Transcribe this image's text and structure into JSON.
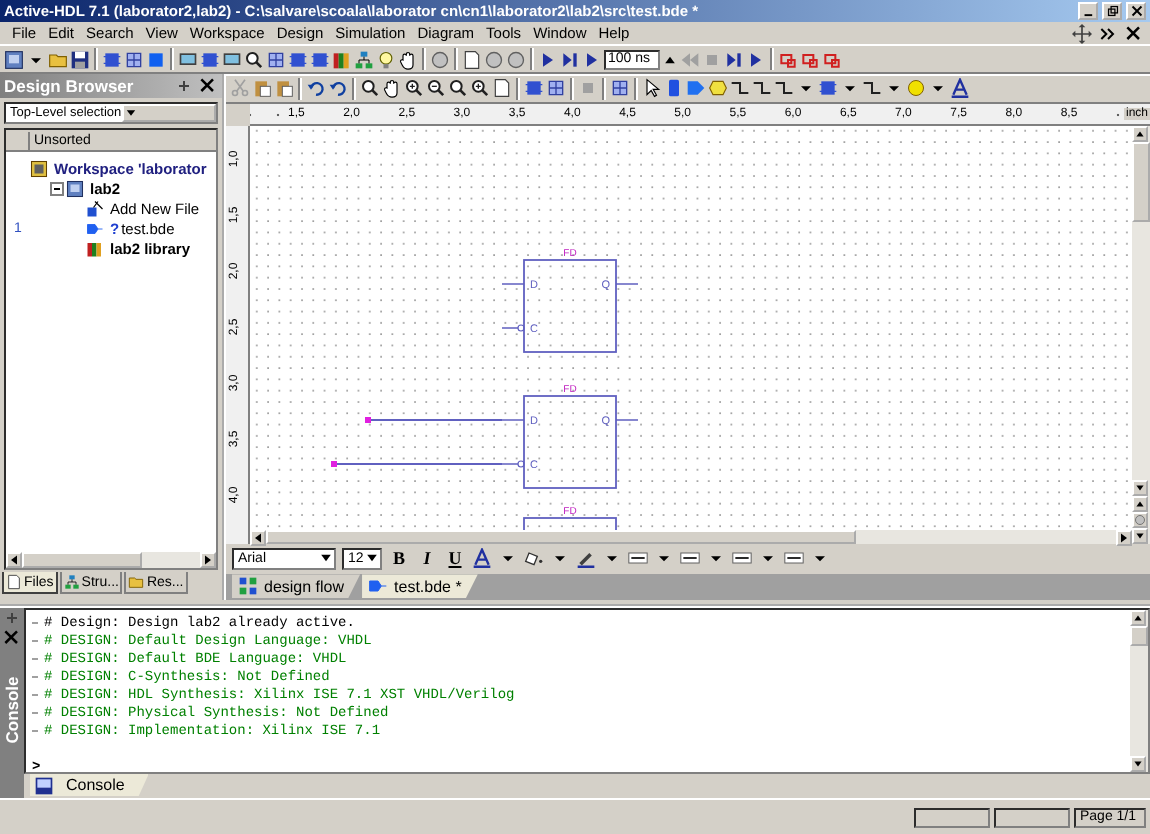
{
  "window": {
    "title": "Active-HDL 7.1 (laborator2,lab2) - C:\\salvare\\scoala\\laborator cn\\cn1\\laborator2\\lab2\\src\\test.bde *"
  },
  "menu": [
    "File",
    "Edit",
    "Search",
    "View",
    "Workspace",
    "Design",
    "Simulation",
    "Diagram",
    "Tools",
    "Window",
    "Help"
  ],
  "sim_toolbar": {
    "time": "100 ns"
  },
  "design_browser": {
    "title": "Design Browser",
    "selector": "Top-Level selection",
    "column": "Unsorted",
    "tree": [
      {
        "label": "Workspace 'laborator",
        "kind": "workspace",
        "children": [
          {
            "label": "lab2",
            "kind": "design",
            "expanded": true,
            "children": [
              {
                "label": "Add New File",
                "kind": "add"
              },
              {
                "label": "test.bde",
                "kind": "bde",
                "status": "?",
                "mark": "1"
              },
              {
                "label": "lab2 library",
                "kind": "library"
              }
            ]
          }
        ]
      }
    ],
    "tabs": [
      {
        "label": "Files",
        "selected": true
      },
      {
        "label": "Stru...",
        "selected": false
      },
      {
        "label": "Res...",
        "selected": false
      }
    ]
  },
  "ruler": {
    "x_labels": [
      "1,5",
      "2,0",
      "2,5",
      "3,0",
      "3,5",
      "4,0",
      "4,5",
      "5,0",
      "5,5",
      "6,0",
      "6,5",
      "7,0",
      "7,5",
      "8,0",
      "8,5"
    ],
    "unit": "inch",
    "y_labels": [
      "1,0",
      "1,5",
      "2,0",
      "2,5",
      "3,0",
      "3,5",
      "4,0"
    ]
  },
  "diagram": {
    "blocks": [
      {
        "name": "FD",
        "pins": [
          "D",
          "Q",
          "C"
        ],
        "inputs_wired": false
      },
      {
        "name": "FD",
        "pins": [
          "D",
          "Q",
          "C"
        ],
        "inputs_wired": true
      },
      {
        "name": "FD"
      }
    ]
  },
  "format_toolbar": {
    "font": "Arial",
    "size": "12",
    "buttons": [
      "B",
      "I",
      "U"
    ]
  },
  "document_tabs": [
    {
      "label": "design flow",
      "kind": "flow",
      "selected": false
    },
    {
      "label": "test.bde *",
      "kind": "bde",
      "selected": true
    }
  ],
  "console": {
    "title": "Console",
    "lines": [
      {
        "text": "# Design: Design lab2 already active.",
        "kind": "info"
      },
      {
        "text": "# DESIGN: Default Design Language: VHDL",
        "kind": "design"
      },
      {
        "text": "# DESIGN: Default BDE Language: VHDL",
        "kind": "design"
      },
      {
        "text": "# DESIGN: C-Synthesis: Not Defined",
        "kind": "design"
      },
      {
        "text": "# DESIGN: HDL Synthesis: Xilinx ISE 7.1 XST VHDL/Verilog",
        "kind": "design"
      },
      {
        "text": "# DESIGN: Physical Synthesis: Not Defined",
        "kind": "design"
      },
      {
        "text": "# DESIGN: Implementation: Xilinx ISE 7.1",
        "kind": "design"
      }
    ],
    "prompt": ">",
    "tab": "Console"
  },
  "status_bar": {
    "page": "Page 1/1"
  }
}
